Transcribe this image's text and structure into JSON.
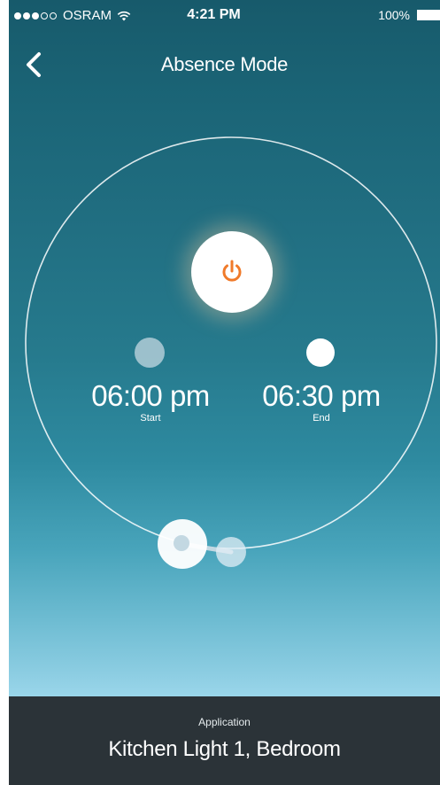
{
  "status_bar": {
    "signal_dots_filled": 3,
    "signal_dots_empty": 2,
    "carrier": "OSRAM",
    "time": "4:21 PM",
    "battery": "100%"
  },
  "nav": {
    "back_icon": "chevron-left-icon",
    "title": "Absence Mode"
  },
  "schedule": {
    "power_icon": "power-icon",
    "accent_color": "#f07a2a",
    "start": {
      "time": "06:00 pm",
      "caption": "Start"
    },
    "end": {
      "time": "06:30 pm",
      "caption": "End"
    }
  },
  "application": {
    "label": "Application",
    "value": "Kitchen Light 1, Bedroom"
  }
}
